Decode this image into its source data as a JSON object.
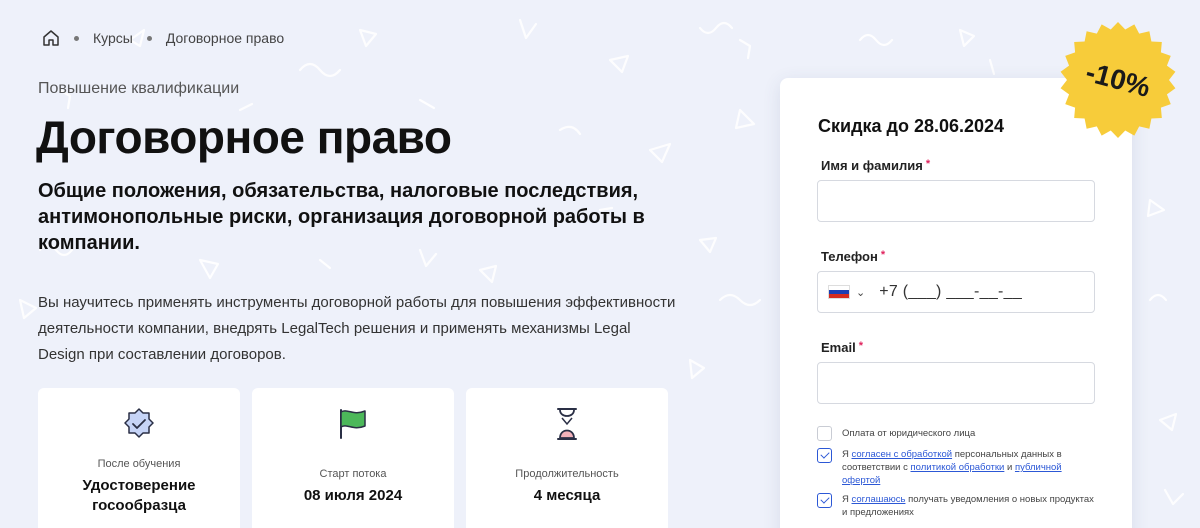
{
  "breadcrumb": {
    "items": [
      "Курсы",
      "Договорное право"
    ]
  },
  "hero": {
    "eyebrow": "Повышение квалификации",
    "title": "Договорное право",
    "subtitle": "Общие положения, обязательства, налоговые последствия, антимонопольные риски, организация договорной работы в компании.",
    "description": "Вы научитесь применять инструменты договорной работы для повышения эффективности деятельности компании, внедрять LegalTech решения и применять механизмы Legal Design при составлении договоров."
  },
  "cards": [
    {
      "icon": "badge-check-icon",
      "label": "После обучения",
      "value": "Удостоверение госообразца"
    },
    {
      "icon": "flag-icon",
      "label": "Старт потока",
      "value": "08 июля 2024"
    },
    {
      "icon": "hourglass-icon",
      "label": "Продолжительность",
      "value": "4 месяца"
    }
  ],
  "discount_badge": "-10%",
  "form": {
    "title": "Скидка до 28.06.2024",
    "name_label": "Имя и фамилия",
    "phone_label": "Телефон",
    "phone_value": "+7 (___) ___-__-__",
    "email_label": "Email",
    "required_mark": "*",
    "legal_entity_label": "Оплата от юридического лица",
    "consent1": {
      "prefix": "Я",
      "link1": "согласен с обработкой",
      "mid1": "персональных данных в соответствии с",
      "link2": "политикой обработки",
      "mid2": "и",
      "link3": "публичной офертой"
    },
    "consent2": {
      "prefix": "Я",
      "link": "соглашаюсь",
      "suffix": "получать уведомления о новых продуктах и предложениях"
    }
  },
  "colors": {
    "accent": "#2c58d6",
    "badge": "#f7cc3a",
    "required": "#e0245e",
    "check_green": "#4cb85a"
  }
}
